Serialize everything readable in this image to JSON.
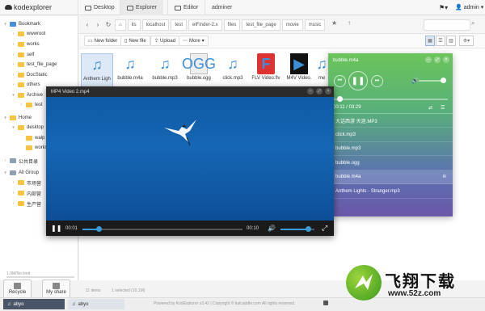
{
  "app": {
    "name": "kodexplorer"
  },
  "topbar": {
    "tabs": [
      {
        "label": "Desktop"
      },
      {
        "label": "Explorer"
      },
      {
        "label": "Editor"
      },
      {
        "label": "adminer"
      }
    ],
    "user": "admin"
  },
  "sidebar": {
    "tree": [
      {
        "label": "Bookmark"
      },
      {
        "label": "wwwroot"
      },
      {
        "label": "works"
      },
      {
        "label": "self"
      },
      {
        "label": "test_file_page"
      },
      {
        "label": "DocStatic"
      },
      {
        "label": "others"
      },
      {
        "label": "Archive"
      },
      {
        "label": "test"
      },
      {
        "label": "Home"
      },
      {
        "label": "desktop"
      },
      {
        "label": "walp"
      },
      {
        "label": "works"
      },
      {
        "label": "公共目录"
      },
      {
        "label": "All Group"
      },
      {
        "label": "市场营"
      },
      {
        "label": "内部营"
      },
      {
        "label": "生产营"
      }
    ],
    "storage": "1.0M/No limit",
    "recycle": "Recycle",
    "share": "My share"
  },
  "address": {
    "crumbs": [
      "its",
      "localhost",
      "test",
      "elFinder-2.x",
      "files",
      "test_file_page",
      "movie",
      "music"
    ]
  },
  "toolbar": {
    "new_folder": "New folder",
    "new_file": "New file",
    "upload": "Upload",
    "more": "More"
  },
  "files": [
    {
      "name": "Anthem Ligh",
      "icon": "music-note-icon"
    },
    {
      "name": "bubble.m4a",
      "icon": "music-note-icon"
    },
    {
      "name": "bubble.mp3",
      "icon": "music-note-icon"
    },
    {
      "name": "bubble.ogg",
      "icon": "ogg-file-icon",
      "badge": "OGG"
    },
    {
      "name": "click.mp3",
      "icon": "music-note-icon"
    },
    {
      "name": "FLV Video.flv",
      "icon": "flv-file-icon",
      "badge": "F"
    },
    {
      "name": "M4V Video.",
      "icon": "clapper-icon",
      "badge": "▶"
    },
    {
      "name": "me",
      "icon": "music-note-icon"
    }
  ],
  "status": {
    "count": "11 items",
    "selected": "1 selected (10.1M)"
  },
  "footer": {
    "copyright": "Powered by KodExplorer v3.42 | Copyright © kalcaddle.com All rights reserved.",
    "tasks": [
      "abyo",
      "abyo"
    ]
  },
  "video": {
    "title": "MP4 Video 2.mp4",
    "current": "00:01",
    "duration": "00:10",
    "progress": 0.1,
    "volume": 0.8
  },
  "music": {
    "title": "bubble.m4a",
    "time": "00:11 / 03:29",
    "progress": 0.05,
    "volume": 0.85,
    "tracks": [
      {
        "name": "大话西游 天涯.MP3"
      },
      {
        "name": "click.mp3"
      },
      {
        "name": "bubble.mp3"
      },
      {
        "name": "bubble.ogg"
      },
      {
        "name": "bubble.m4a",
        "current": true
      },
      {
        "name": "Anthem Lights - Stranger.mp3"
      }
    ]
  },
  "watermark": {
    "text": "飞翔下载",
    "url": "www.52z.com"
  },
  "colors": {
    "accent": "#3a9ad9",
    "video_bg": "#1566b4",
    "player_top": "#6bc45a",
    "player_bottom": "#6c57a8"
  }
}
